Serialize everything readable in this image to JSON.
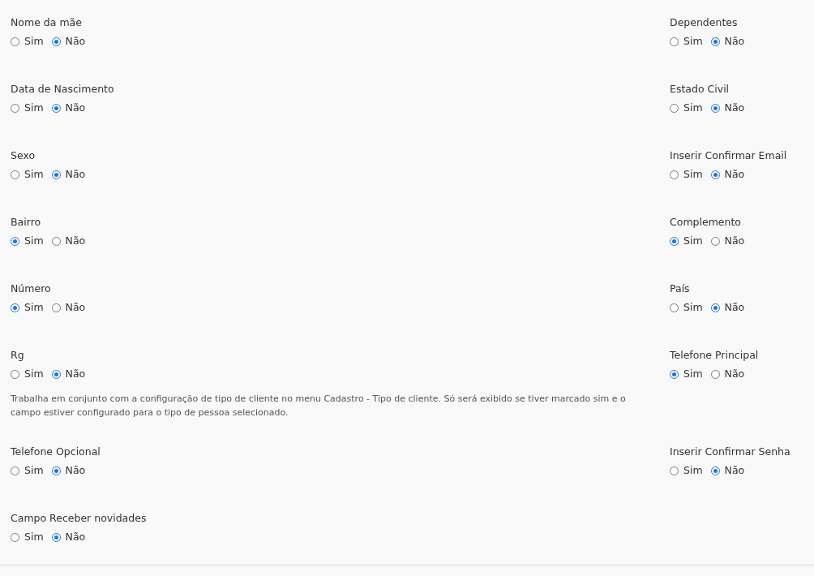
{
  "rows": [
    {
      "left": {
        "label": "Nome da mãe",
        "options": [
          {
            "label": "Sim",
            "selected": false
          },
          {
            "label": "Não",
            "selected": true
          }
        ]
      },
      "right": {
        "label": "Dependentes",
        "options": [
          {
            "label": "Sim",
            "selected": false
          },
          {
            "label": "Não",
            "selected": true
          }
        ]
      }
    },
    {
      "left": {
        "label": "Data de Nascimento",
        "options": [
          {
            "label": "Sim",
            "selected": false
          },
          {
            "label": "Não",
            "selected": true
          }
        ]
      },
      "right": {
        "label": "Estado Civil",
        "options": [
          {
            "label": "Sim",
            "selected": false
          },
          {
            "label": "Não",
            "selected": true
          }
        ]
      }
    },
    {
      "left": {
        "label": "Sexo",
        "options": [
          {
            "label": "Sim",
            "selected": false
          },
          {
            "label": "Não",
            "selected": true
          }
        ]
      },
      "right": {
        "label": "Inserir Confirmar Email",
        "options": [
          {
            "label": "Sim",
            "selected": false
          },
          {
            "label": "Não",
            "selected": true
          }
        ]
      }
    },
    {
      "left": {
        "label": "Bairro",
        "options": [
          {
            "label": "Sim",
            "selected": true
          },
          {
            "label": "Não",
            "selected": false
          }
        ]
      },
      "right": {
        "label": "Complemento",
        "options": [
          {
            "label": "Sim",
            "selected": true
          },
          {
            "label": "Não",
            "selected": false
          }
        ]
      }
    },
    {
      "left": {
        "label": "Número",
        "options": [
          {
            "label": "Sim",
            "selected": true
          },
          {
            "label": "Não",
            "selected": false
          }
        ]
      },
      "right": {
        "label": "País",
        "options": [
          {
            "label": "Sim",
            "selected": false
          },
          {
            "label": "Não",
            "selected": true
          }
        ]
      }
    },
    {
      "left": {
        "label": "Rg",
        "options": [
          {
            "label": "Sim",
            "selected": false
          },
          {
            "label": "Não",
            "selected": true
          }
        ],
        "note": "Trabalha em conjunto com a configuração de tipo de cliente no menu Cadastro - Tipo de cliente. Só será exibido se tiver marcado sim e o campo estiver configurado para o tipo de pessoa selecionado."
      },
      "right": {
        "label": "Telefone Principal",
        "options": [
          {
            "label": "Sim",
            "selected": true
          },
          {
            "label": "Não",
            "selected": false
          }
        ]
      }
    },
    {
      "left": {
        "label": "Telefone Opcional",
        "options": [
          {
            "label": "Sim",
            "selected": false
          },
          {
            "label": "Não",
            "selected": true
          }
        ]
      },
      "right": {
        "label": "Inserir Confirmar Senha",
        "options": [
          {
            "label": "Sim",
            "selected": false
          },
          {
            "label": "Não",
            "selected": true
          }
        ]
      }
    },
    {
      "left": {
        "label": "Campo Receber novidades",
        "options": [
          {
            "label": "Sim",
            "selected": false
          },
          {
            "label": "Não",
            "selected": true
          }
        ]
      }
    }
  ]
}
